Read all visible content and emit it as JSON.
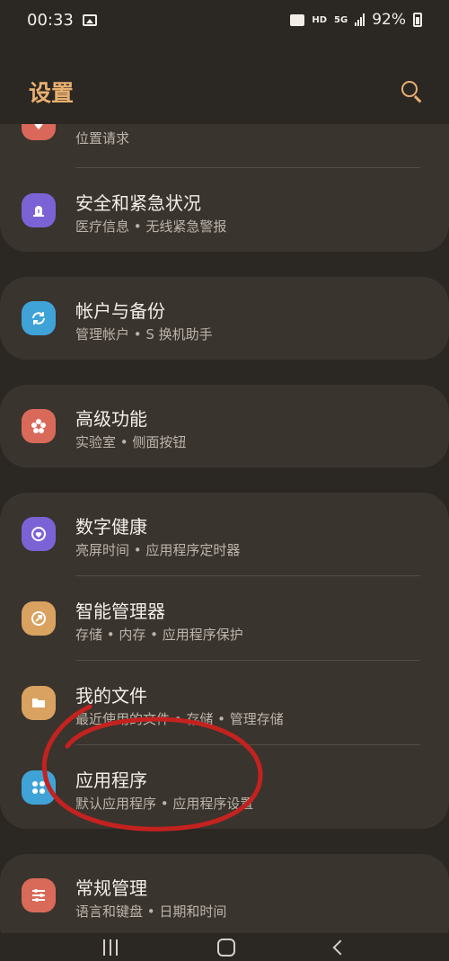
{
  "status_bar": {
    "time": "00:33",
    "network_hd": "HD",
    "network_5g": "5G",
    "battery": "92%"
  },
  "header": {
    "title": "设置",
    "search_icon": "search-icon"
  },
  "colors": {
    "accent": "#e8b070",
    "background": "#2b2723",
    "card": "#3a342e",
    "annotation_red": "#c4221f"
  },
  "settings": [
    {
      "title": "",
      "subtitle": "位置请求",
      "icon": "location-pin-icon",
      "icon_color": "#d9685a"
    },
    {
      "title": "安全和紧急状况",
      "subtitle": "医疗信息 • 无线紧急警报",
      "icon": "emergency-alert-icon",
      "icon_color": "#7b63d6"
    },
    {
      "title": "帐户与备份",
      "subtitle": "管理帐户 • S 换机助手",
      "icon": "sync-icon",
      "icon_color": "#3fa3d8"
    },
    {
      "title": "高级功能",
      "subtitle": "实验室 • 侧面按钮",
      "icon": "gear-flower-icon",
      "icon_color": "#d96a5a"
    },
    {
      "title": "数字健康",
      "subtitle": "亮屏时间 • 应用程序定时器",
      "icon": "digital-wellbeing-icon",
      "icon_color": "#7b63d6"
    },
    {
      "title": "智能管理器",
      "subtitle": "存储 • 内存 • 应用程序保护",
      "icon": "device-care-icon",
      "icon_color": "#d9a260"
    },
    {
      "title": "我的文件",
      "subtitle": "最近使用的文件 • 存储 • 管理存储",
      "icon": "folder-icon",
      "icon_color": "#d9a260"
    },
    {
      "title": "应用程序",
      "subtitle": "默认应用程序 • 应用程序设置",
      "icon": "apps-grid-icon",
      "icon_color": "#3fa3d8"
    },
    {
      "title": "常规管理",
      "subtitle": "语言和键盘 • 日期和时间",
      "icon": "sliders-icon",
      "icon_color": "#d96a5a"
    }
  ],
  "nav_bar": {
    "recent": "recent-apps-icon",
    "home": "home-icon",
    "back": "back-icon"
  }
}
